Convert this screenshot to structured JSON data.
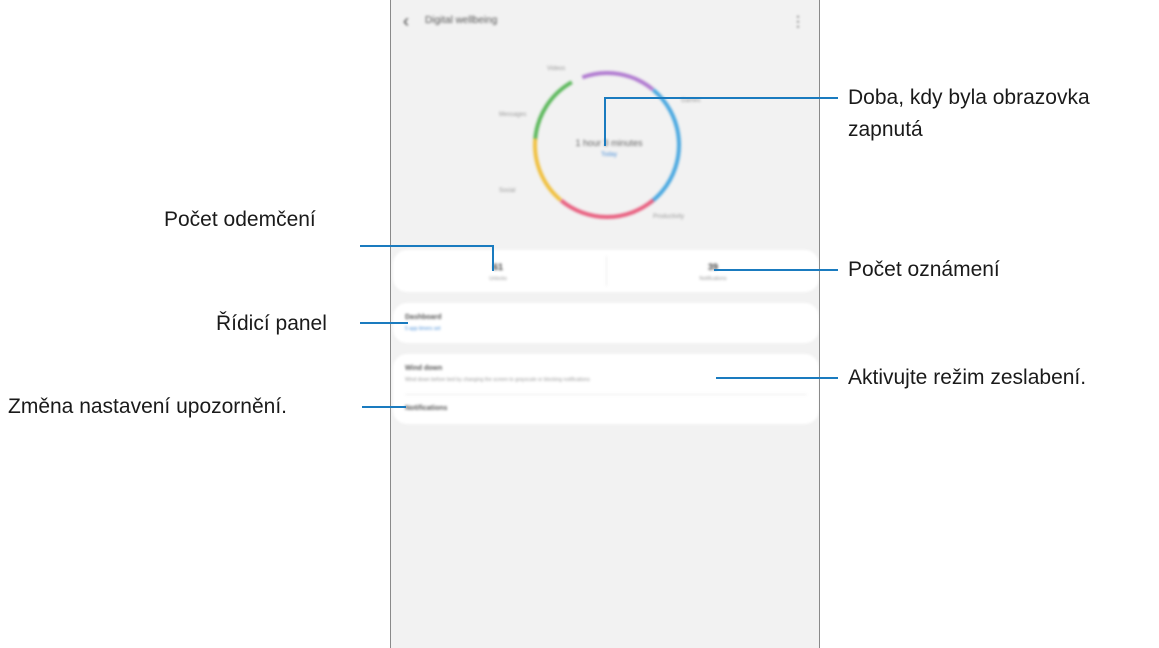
{
  "app": {
    "title": "Digital wellbeing",
    "back_icon": "back-arrow-icon",
    "more_icon": "more-options-icon"
  },
  "ring": {
    "time": "1 hour 3 minutes",
    "day": "Today",
    "labels": [
      "Videos",
      "Games",
      "Messages",
      "Social",
      "Productivity"
    ],
    "colors": [
      "#b07ad0",
      "#4aa8e0",
      "#e86080",
      "#f0c040",
      "#5cb85c"
    ]
  },
  "stats": {
    "unlocks_value": "61",
    "unlocks_label": "Unlocks",
    "notifications_value": "39",
    "notifications_label": "Notifications"
  },
  "dashboard": {
    "title": "Dashboard",
    "subtitle": "5 app timers set"
  },
  "wind_down": {
    "title": "Wind down",
    "description": "Wind down before bed by changing the screen to grayscale or blocking notifications"
  },
  "notifications_item": {
    "title": "Notifications"
  },
  "callouts": {
    "screen_on_line1": "Doba, kdy byla obrazovka",
    "screen_on_line2": "zapnutá",
    "unlocks": "Počet odemčení",
    "notifications_count": "Počet oznámení",
    "dashboard": "Řídicí panel",
    "wind_down": "Aktivujte režim zeslabení.",
    "notification_settings": "Změna nastavení upozornění."
  },
  "accent_color": "#1a7bbf"
}
